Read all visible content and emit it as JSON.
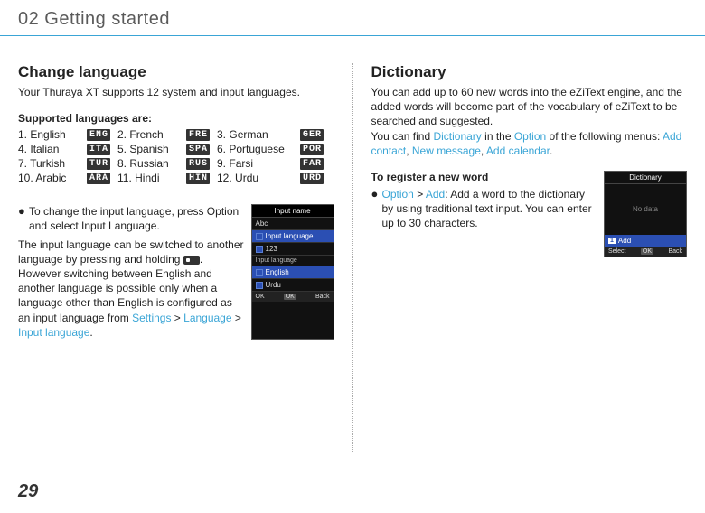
{
  "chapter": "02 Getting started",
  "page_number": "29",
  "left": {
    "title": "Change language",
    "intro": "Your Thuraya XT supports 12 system and input languages.",
    "supported_heading": "Supported languages are:",
    "languages": [
      {
        "num": "1.",
        "name": "English",
        "code": "ENG"
      },
      {
        "num": "2.",
        "name": "French",
        "code": "FRE"
      },
      {
        "num": "3.",
        "name": "German",
        "code": "GER"
      },
      {
        "num": "4.",
        "name": "Italian",
        "code": "ITA"
      },
      {
        "num": "5.",
        "name": "Spanish",
        "code": "SPA"
      },
      {
        "num": "6.",
        "name": "Portuguese",
        "code": "POR"
      },
      {
        "num": "7.",
        "name": "Turkish",
        "code": "TUR"
      },
      {
        "num": "8.",
        "name": "Russian",
        "code": "RUS"
      },
      {
        "num": "9.",
        "name": "Farsi",
        "code": "FAR"
      },
      {
        "num": "10.",
        "name": "Arabic",
        "code": "ARA"
      },
      {
        "num": "11.",
        "name": "Hindi",
        "code": "HIN"
      },
      {
        "num": "12.",
        "name": "Urdu",
        "code": "URD"
      }
    ],
    "bullet": "To change the input language, press Option and select Input Language.",
    "para_pre": "The input language can be switched to another language by pressing and holding ",
    "para_post1": ". However switching between English and another language is possible only when a language other than English is configured as an input language from ",
    "settings_link": "Settings",
    "sep1": " > ",
    "language_link": "Language",
    "sep2": " > ",
    "input_language_link": "Input language",
    "period": ".",
    "screenshot": {
      "title": "Input name",
      "indicator": "Abc",
      "row1": "Input language",
      "row1_sub": "123",
      "sub_header": "Input language",
      "opt1": "English",
      "opt2": "Urdu",
      "foot_left": "OK",
      "foot_mid": "OK",
      "foot_right": "Back"
    }
  },
  "right": {
    "title": "Dictionary",
    "intro_1": "You can add up to 60 new words into the eZiText engine, and the added words will become part of the vocabulary of eZiText to be searched and suggested.",
    "intro_2a": "You can find ",
    "dict_link": "Dictionary",
    "intro_2b": " in the ",
    "option_link": "Option",
    "intro_2c": " of the following menus: ",
    "addcontact_link": "Add contact",
    "comma1": ", ",
    "newmsg_link": "New message",
    "comma2": ", ",
    "addcal_link": "Add calendar",
    "period2": ".",
    "register_heading": "To register a new word",
    "bullet_option": "Option",
    "bullet_sep": " > ",
    "bullet_add": "Add",
    "bullet_rest": ": Add a word to the dictionary by using traditional text input. You can enter up to 30 characters.",
    "screenshot": {
      "title": "Dictionary",
      "body": "No data",
      "add_num": "1",
      "add_label": "Add",
      "foot_left": "Select",
      "foot_mid": "OK",
      "foot_right": "Back"
    }
  }
}
